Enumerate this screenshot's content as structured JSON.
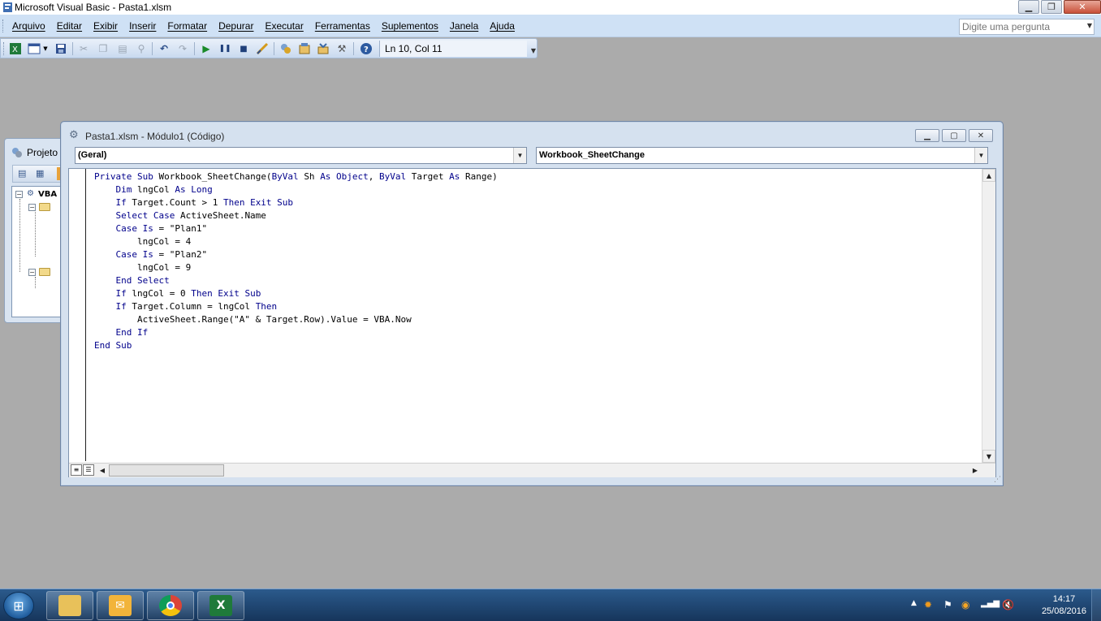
{
  "window": {
    "title": "Microsoft Visual Basic - Pasta1.xlsm"
  },
  "window_controls": {
    "minimize": "▁",
    "restore": "❐",
    "close": "✕"
  },
  "menu": {
    "items": [
      "Arquivo",
      "Editar",
      "Exibir",
      "Inserir",
      "Formatar",
      "Depurar",
      "Executar",
      "Ferramentas",
      "Suplementos",
      "Janela",
      "Ajuda"
    ]
  },
  "help": {
    "placeholder": "Digite uma pergunta"
  },
  "toolbar": {
    "position": "Ln 10, Col 11",
    "icons": [
      "excel-view-icon",
      "insert-userform-icon",
      "save-icon",
      "cut-icon",
      "copy-icon",
      "paste-icon",
      "find-icon",
      "undo-icon",
      "redo-icon",
      "run-icon",
      "break-icon",
      "reset-icon",
      "design-mode-icon",
      "project-explorer-icon",
      "properties-icon",
      "object-browser-icon",
      "toolbox-icon",
      "help-icon"
    ]
  },
  "project_window": {
    "title": "Projeto",
    "root": "VBA"
  },
  "code_window": {
    "title": "Pasta1.xlsm - Módulo1 (Código)",
    "object_combo": "(Geral)",
    "procedure_combo": "Workbook_SheetChange",
    "lines": [
      [
        {
          "t": "Private Sub ",
          "k": true
        },
        {
          "t": "Workbook_SheetChange(",
          "k": false
        },
        {
          "t": "ByVal ",
          "k": true
        },
        {
          "t": "Sh ",
          "k": false
        },
        {
          "t": "As Object",
          "k": true
        },
        {
          "t": ", ",
          "k": false
        },
        {
          "t": "ByVal ",
          "k": true
        },
        {
          "t": "Target ",
          "k": false
        },
        {
          "t": "As ",
          "k": true
        },
        {
          "t": "Range)",
          "k": false
        }
      ],
      [
        {
          "t": "    Dim ",
          "k": true
        },
        {
          "t": "lngCol ",
          "k": false
        },
        {
          "t": "As Long",
          "k": true
        }
      ],
      [
        {
          "t": "    If ",
          "k": true
        },
        {
          "t": "Target.Count > 1 ",
          "k": false
        },
        {
          "t": "Then Exit Sub",
          "k": true
        }
      ],
      [
        {
          "t": "    Select Case ",
          "k": true
        },
        {
          "t": "ActiveSheet.Name",
          "k": false
        }
      ],
      [
        {
          "t": "    Case Is ",
          "k": true
        },
        {
          "t": "= \"Plan1\"",
          "k": false
        }
      ],
      [
        {
          "t": "        lngCol = 4",
          "k": false
        }
      ],
      [
        {
          "t": "    Case Is ",
          "k": true
        },
        {
          "t": "= \"Plan2\"",
          "k": false
        }
      ],
      [
        {
          "t": "        lngCol = 9",
          "k": false
        }
      ],
      [
        {
          "t": "    End Select",
          "k": true
        }
      ],
      [
        {
          "t": "    If ",
          "k": true
        },
        {
          "t": "lngCol = 0 ",
          "k": false
        },
        {
          "t": "Then Exit Sub",
          "k": true
        }
      ],
      [
        {
          "t": "    If ",
          "k": true
        },
        {
          "t": "Target.Column = lngCol ",
          "k": false
        },
        {
          "t": "Then",
          "k": true
        }
      ],
      [
        {
          "t": "        ActiveSheet.Range(\"A\" & Target.Row).Value = VBA.Now",
          "k": false
        }
      ],
      [
        {
          "t": "    End If",
          "k": true
        }
      ],
      [
        {
          "t": "End Sub",
          "k": true
        }
      ]
    ]
  },
  "taskbar": {
    "apps": [
      "file-explorer-icon",
      "outlook-icon",
      "chrome-icon",
      "excel-icon"
    ],
    "clock": {
      "time": "14:17",
      "date": "25/08/2016"
    }
  },
  "colors": {
    "keyword": "#00008b",
    "menubar": "#cfe1f5",
    "background": "#ababab"
  }
}
